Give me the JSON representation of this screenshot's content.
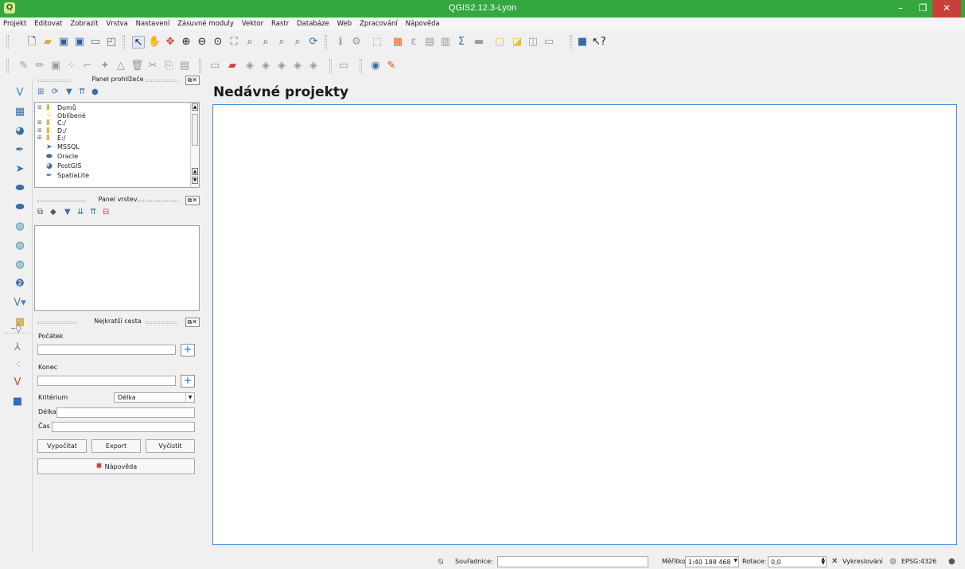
{
  "window": {
    "title": "QGIS2.12.3-Lyon",
    "app_icon": "qgis-logo-icon",
    "minimize": "–",
    "maximize": "❐",
    "close": "✕"
  },
  "menu": [
    "Projekt",
    "Editovat",
    "Zobrazit",
    "Vrstva",
    "Nastavení",
    "Zásuvné moduly",
    "Vektor",
    "Rastr",
    "Databáze",
    "Web",
    "Zpracování",
    "Nápověda"
  ],
  "browser_panel": {
    "title": "Panel prohlížeče",
    "items": [
      {
        "label": "Domů",
        "icon": "folder-icon",
        "expand": "⊞"
      },
      {
        "label": "Oblíbené",
        "icon": "star-icon",
        "expand": ""
      },
      {
        "label": "C:/",
        "icon": "folder-icon",
        "expand": "⊞"
      },
      {
        "label": "D:/",
        "icon": "folder-icon",
        "expand": "⊞"
      },
      {
        "label": "E:/",
        "icon": "folder-icon",
        "expand": "⊞"
      },
      {
        "label": "MSSQL",
        "icon": "mssql-icon",
        "expand": ""
      },
      {
        "label": "Oracle",
        "icon": "oracle-icon",
        "expand": ""
      },
      {
        "label": "PostGIS",
        "icon": "postgis-icon",
        "expand": ""
      },
      {
        "label": "SpatiaLite",
        "icon": "spatialite-icon",
        "expand": ""
      }
    ]
  },
  "layers_panel": {
    "title": "Panel vrstev"
  },
  "route_panel": {
    "title": "Nejkratší cesta",
    "start_label": "Počátek",
    "start_value": "",
    "end_label": "Konec",
    "end_value": "",
    "criterion_label": "Kritérium",
    "criterion_value": "Délka",
    "length_label": "Délka",
    "length_value": "",
    "time_label": "Čas",
    "time_value": "",
    "calculate_btn": "Vypočítat",
    "export_btn": "Export",
    "clear_btn": "Vyčistit",
    "help_btn": "Nápověda"
  },
  "main": {
    "heading": "Nedávné projekty"
  },
  "status": {
    "coords_label": "Souřadnice:",
    "coords_value": "",
    "scale_label": "Měřítko",
    "scale_value": "1:40 188 468",
    "rotation_label": "Rotace:",
    "rotation_value": "0,0",
    "render_label": "Vykreslování",
    "crs": "EPSG:4326"
  },
  "colors": {
    "titlebar": "#34a83e",
    "close_button": "#c7413a",
    "accent_border": "#3f87d8"
  }
}
